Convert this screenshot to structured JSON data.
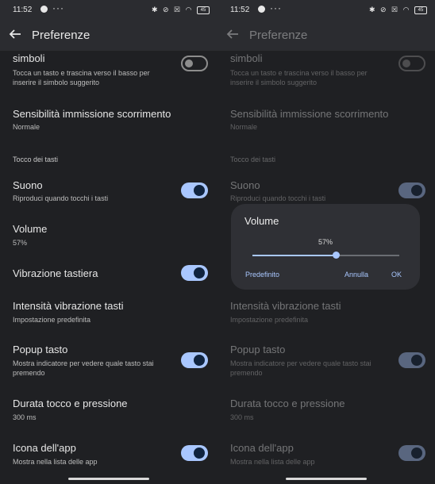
{
  "status": {
    "time": "11:52",
    "dots": "···",
    "icons": "✱ ⊘ ☒ ◠",
    "battery": "45"
  },
  "appbar": {
    "title": "Preferenze"
  },
  "rows": {
    "symbols": {
      "title": "simboli",
      "sub": "Tocca un tasto e trascina verso il basso per inserire il simbolo suggerito",
      "toggle": false
    },
    "swipe": {
      "title": "Sensibilità immissione scorrimento",
      "sub": "Normale"
    },
    "section": "Tocco dei tasti",
    "sound": {
      "title": "Suono",
      "sub": "Riproduci quando tocchi i tasti",
      "toggle": true
    },
    "volume": {
      "title": "Volume",
      "sub": "57%"
    },
    "vibration": {
      "title": "Vibrazione tastiera",
      "toggle": true
    },
    "intensity": {
      "title": "Intensità vibrazione tasti",
      "sub": "Impostazione predefinita"
    },
    "popup": {
      "title": "Popup tasto",
      "sub": "Mostra indicatore per vedere quale tasto stai premendo",
      "toggle": true
    },
    "duration": {
      "title": "Durata tocco e pressione",
      "sub": "300 ms"
    },
    "appicon": {
      "title": "Icona dell'app",
      "sub": "Mostra nella lista delle app",
      "toggle": true
    }
  },
  "dialog": {
    "title": "Volume",
    "value_label": "57%",
    "value": 0.57,
    "default_button": "Predefinito",
    "cancel_button": "Annulla",
    "ok_button": "OK"
  },
  "colors": {
    "accent": "#a9c7ff",
    "background": "#1f2023",
    "appbar": "#2b2c30",
    "dialog": "#2f3035"
  }
}
